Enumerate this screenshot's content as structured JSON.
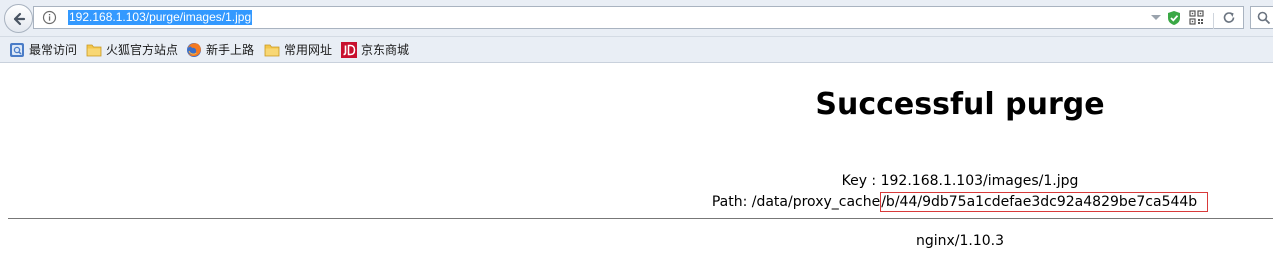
{
  "browser": {
    "url": "192.168.1.103/purge/images/1.jpg",
    "bookmarks": [
      {
        "label": "最常访问",
        "icon": "frequent-sites-icon"
      },
      {
        "label": "火狐官方站点",
        "icon": "folder-icon"
      },
      {
        "label": "新手上路",
        "icon": "firefox-icon"
      },
      {
        "label": "常用网址",
        "icon": "folder-icon"
      },
      {
        "label": "京东商城",
        "icon": "jd-logo-icon"
      }
    ]
  },
  "page": {
    "title": "Successful purge",
    "key_label": "Key :",
    "key_value": "192.168.1.103/images/1.jpg",
    "path_label": "Path:",
    "path_prefix": "/data/proxy_cache",
    "path_highlight": "/b/44/9db75a1cdefae3dc92a4829be7ca544b",
    "footer": "nginx/1.10.3"
  },
  "colors": {
    "highlight_border": "#d83a3a",
    "url_selection": "#3399ff",
    "shield_green": "#3aa845"
  }
}
